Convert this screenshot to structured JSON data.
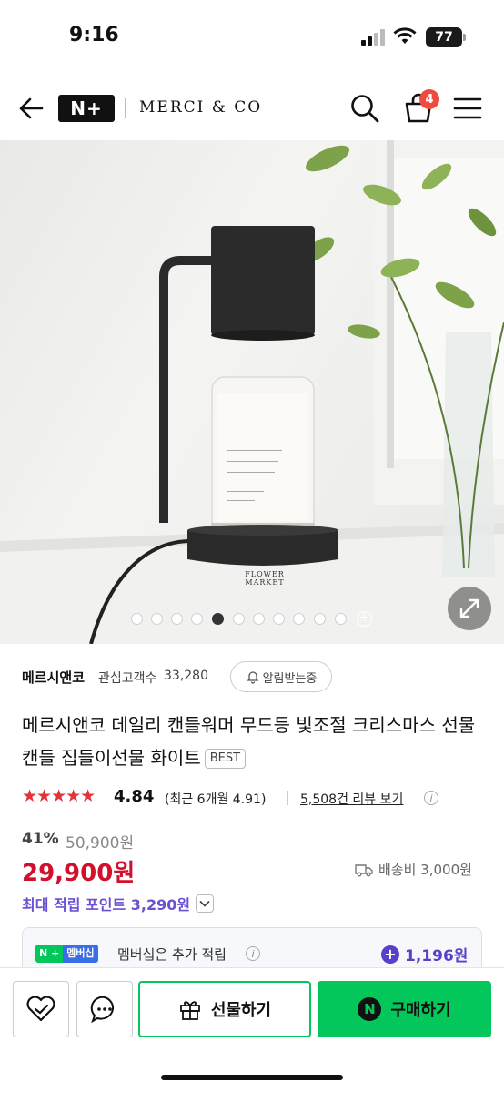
{
  "status_bar": {
    "time": "9:16",
    "battery": "77"
  },
  "header": {
    "logo": "N+",
    "brand": "MERCI & CO",
    "cart_count": "4"
  },
  "gallery": {
    "image_count": 11,
    "active_index": 4,
    "jar_label": "FLOWER MARKET"
  },
  "store": {
    "name": "메르시앤코",
    "follower_label": "관심고객수",
    "follower_count": "33,280",
    "alarm_label": "알림받는중"
  },
  "product": {
    "title": "메르시앤코 데일리 캔들워머 무드등 빛조절 크리스마스 선물 캔들 집들이선물 화이트",
    "badge": "BEST"
  },
  "rating": {
    "stars": "★★★★★",
    "score": "4.84",
    "recent": "(최근 6개월 4.91)",
    "review_link": "5,508건 리뷰 보기"
  },
  "price": {
    "discount": "41%",
    "original": "50,900원",
    "sale": "29,900원",
    "shipping": "배송비 3,000원",
    "points": "최대 적립 포인트 3,290원"
  },
  "membership": {
    "badge_left": "N +",
    "badge_right": "멤버십",
    "text": "멤버십은 추가 적립",
    "points": "1,196원"
  },
  "bottom_bar": {
    "gift_label": "선물하기",
    "buy_label": "구매하기",
    "buy_icon": "N"
  },
  "colors": {
    "naver_green": "#03c75a",
    "price_red": "#d1102c",
    "points_purple": "#6d4fd2",
    "star_red": "#e0363b",
    "badge_red": "#f04a3e"
  }
}
